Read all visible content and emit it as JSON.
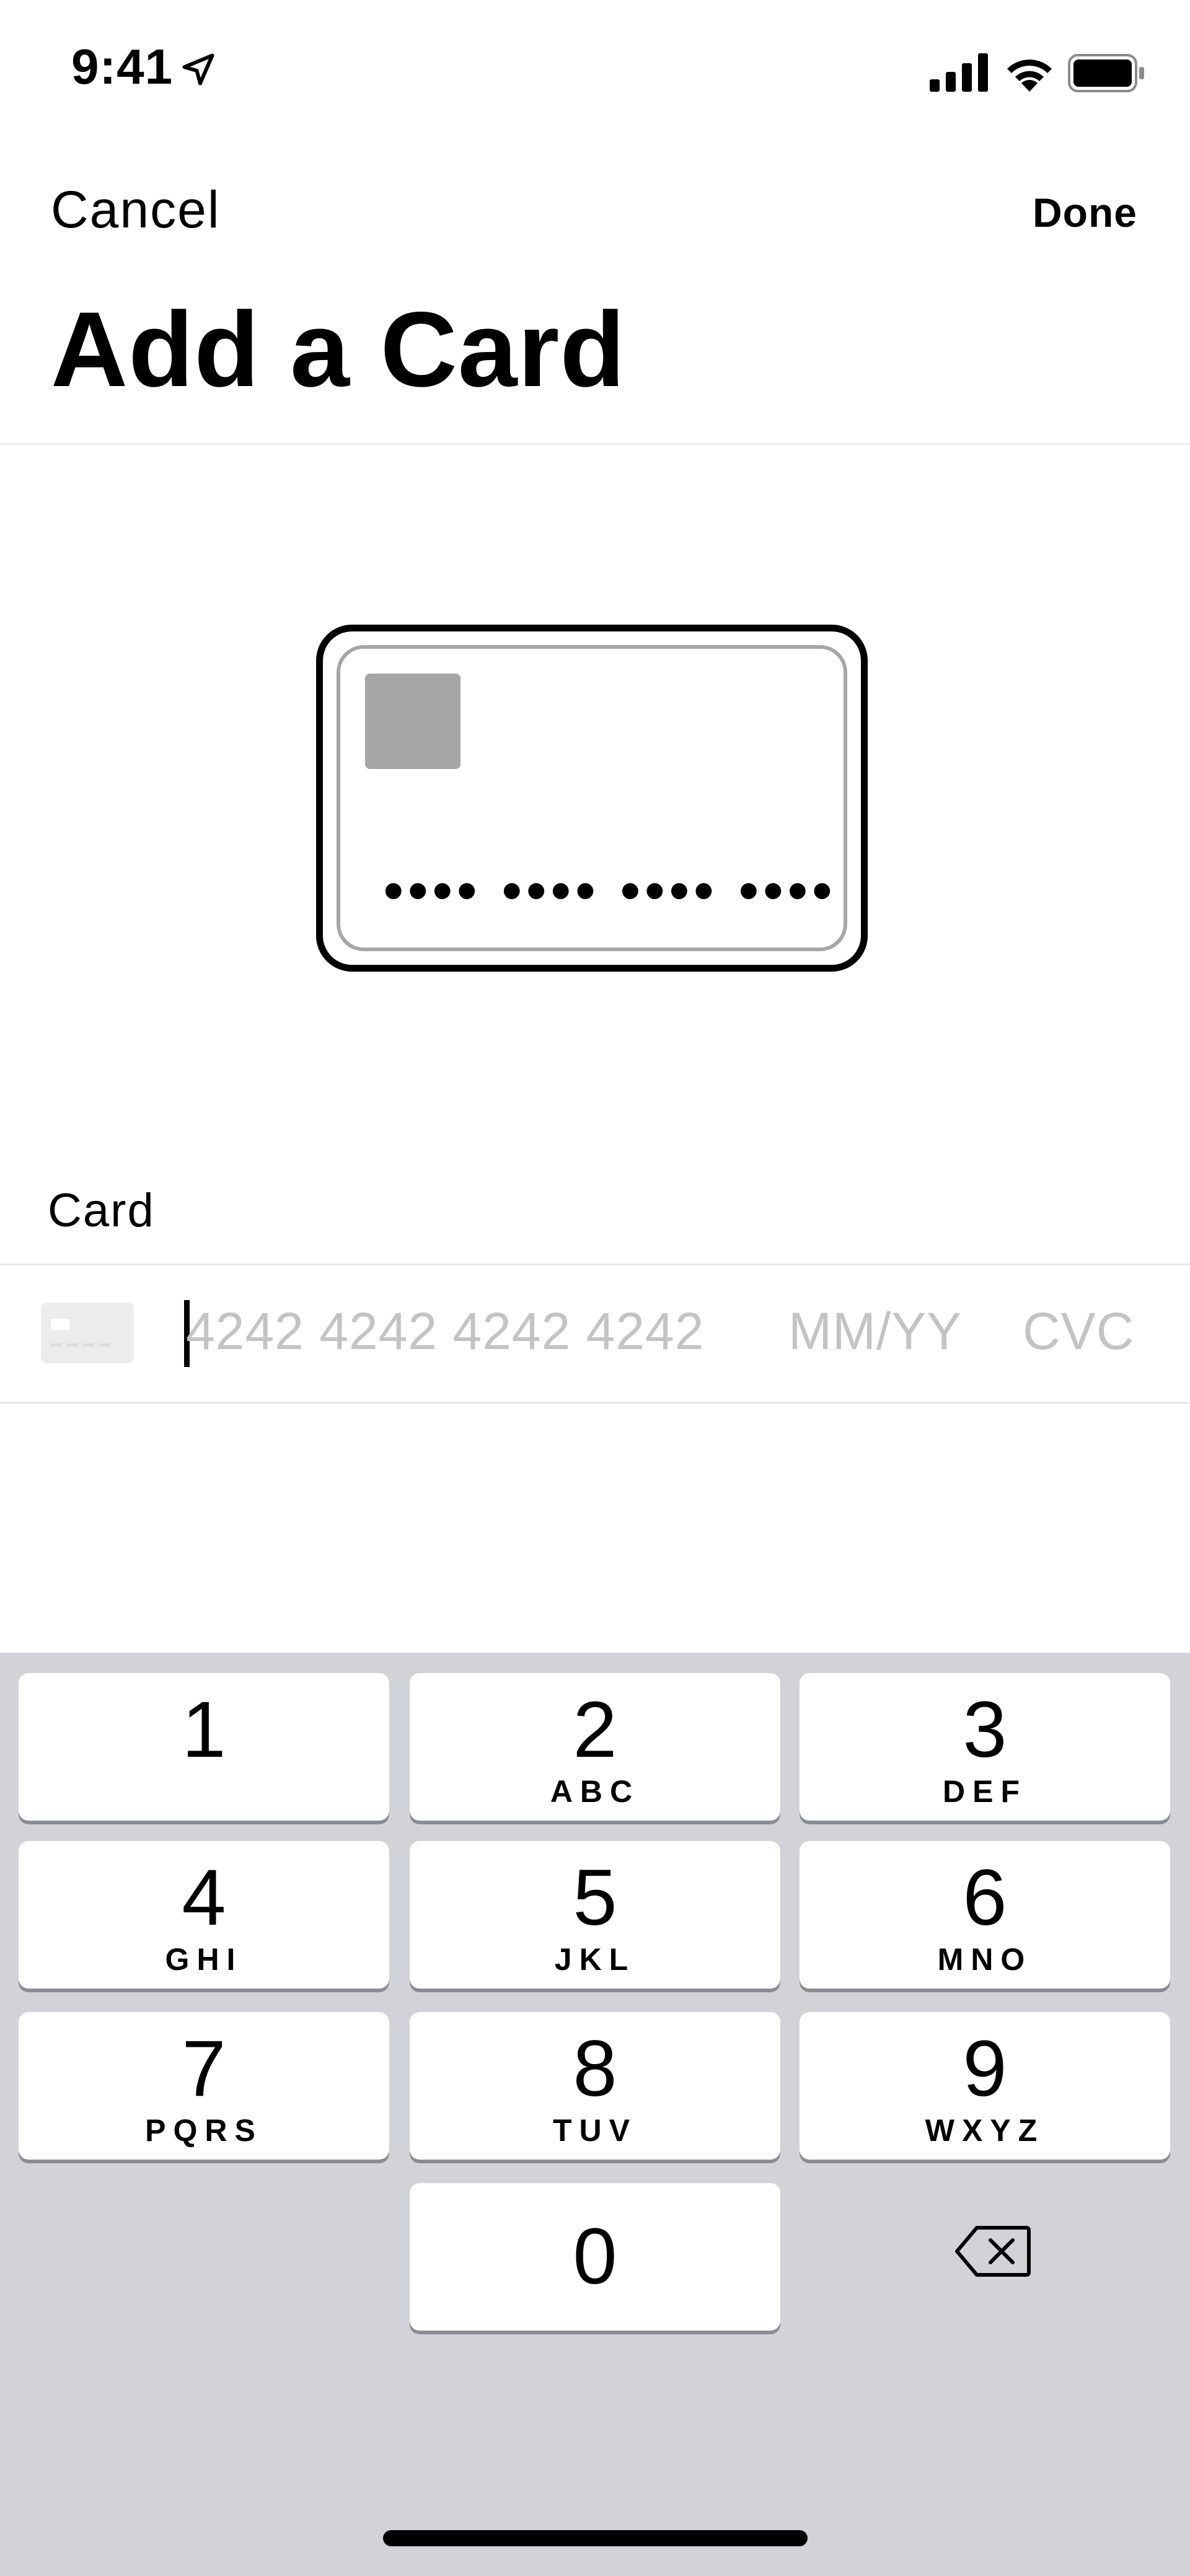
{
  "status_bar": {
    "time": "9:41"
  },
  "nav": {
    "cancel_label": "Cancel",
    "done_label": "Done",
    "title": "Add a Card"
  },
  "card_preview": {
    "number_mask": "•••• •••• •••• ••••"
  },
  "form": {
    "card_label": "Card",
    "number_placeholder": "4242 4242 4242 4242",
    "expiry_placeholder": "MM/YY",
    "cvc_placeholder": "CVC"
  },
  "keypad": {
    "keys": [
      {
        "digit": "1",
        "letters": ""
      },
      {
        "digit": "2",
        "letters": "ABC"
      },
      {
        "digit": "3",
        "letters": "DEF"
      },
      {
        "digit": "4",
        "letters": "GHI"
      },
      {
        "digit": "5",
        "letters": "JKL"
      },
      {
        "digit": "6",
        "letters": "MNO"
      },
      {
        "digit": "7",
        "letters": "PQRS"
      },
      {
        "digit": "8",
        "letters": "TUV"
      },
      {
        "digit": "9",
        "letters": "WXYZ"
      },
      {
        "digit": "0",
        "letters": ""
      }
    ],
    "delete_icon": "backspace-icon"
  },
  "colors": {
    "keypad_bg": "#d1d3d9",
    "placeholder": "#c3c3c3",
    "chip": "#a6a6a6"
  }
}
